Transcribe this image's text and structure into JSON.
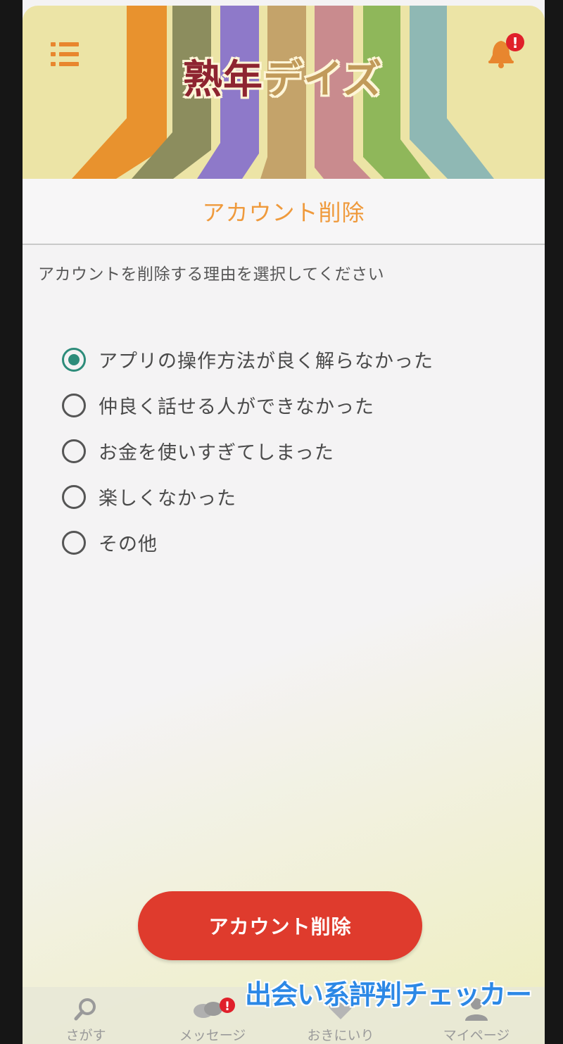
{
  "app": {
    "logo_kanji": "熟年",
    "logo_kana": "デイズ",
    "notification_badge": "!"
  },
  "page": {
    "title": "アカウント削除",
    "prompt": "アカウントを削除する理由を選択してください"
  },
  "options": [
    {
      "label": "アプリの操作方法が良く解らなかった",
      "checked": true
    },
    {
      "label": "仲良く話せる人ができなかった",
      "checked": false
    },
    {
      "label": "お金を使いすぎてしまった",
      "checked": false
    },
    {
      "label": "楽しくなかった",
      "checked": false
    },
    {
      "label": "その他",
      "checked": false
    }
  ],
  "delete_button": {
    "label": "アカウント削除"
  },
  "tabbar": {
    "tabs": [
      {
        "label": "さがす",
        "icon": "search-icon"
      },
      {
        "label": "メッセージ",
        "icon": "chat-icon",
        "badge": "!"
      },
      {
        "label": "おきにいり",
        "icon": "heart-icon"
      },
      {
        "label": "マイページ",
        "icon": "person-icon"
      }
    ]
  },
  "watermark": "出会い系評判チェッカー",
  "colors": {
    "accent": "#ef9a3c",
    "delete": "#df3b2d",
    "radio_checked": "#2d8c7a",
    "badge": "#e0202a"
  }
}
